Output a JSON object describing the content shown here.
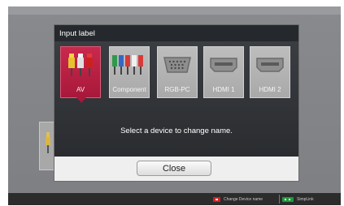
{
  "dialog": {
    "title": "Input label",
    "message": "Select a device to change name.",
    "close_label": "Close"
  },
  "inputs": [
    {
      "label": "AV",
      "icon": "av-rca-icon",
      "selected": true
    },
    {
      "label": "Component",
      "icon": "component-rca-icon",
      "selected": false
    },
    {
      "label": "RGB-PC",
      "icon": "vga-port-icon",
      "selected": false
    },
    {
      "label": "HDMI 1",
      "icon": "hdmi-port-icon",
      "selected": false
    },
    {
      "label": "HDMI 2",
      "icon": "hdmi-port-icon",
      "selected": false
    }
  ],
  "footer": {
    "red_action": "Change Device name",
    "green_action": "SimpLink"
  },
  "colors": {
    "selected_tile": "#b81f42",
    "title_bar": "#25282c",
    "red_button": "#d42020",
    "green_button": "#1f9a3a"
  }
}
